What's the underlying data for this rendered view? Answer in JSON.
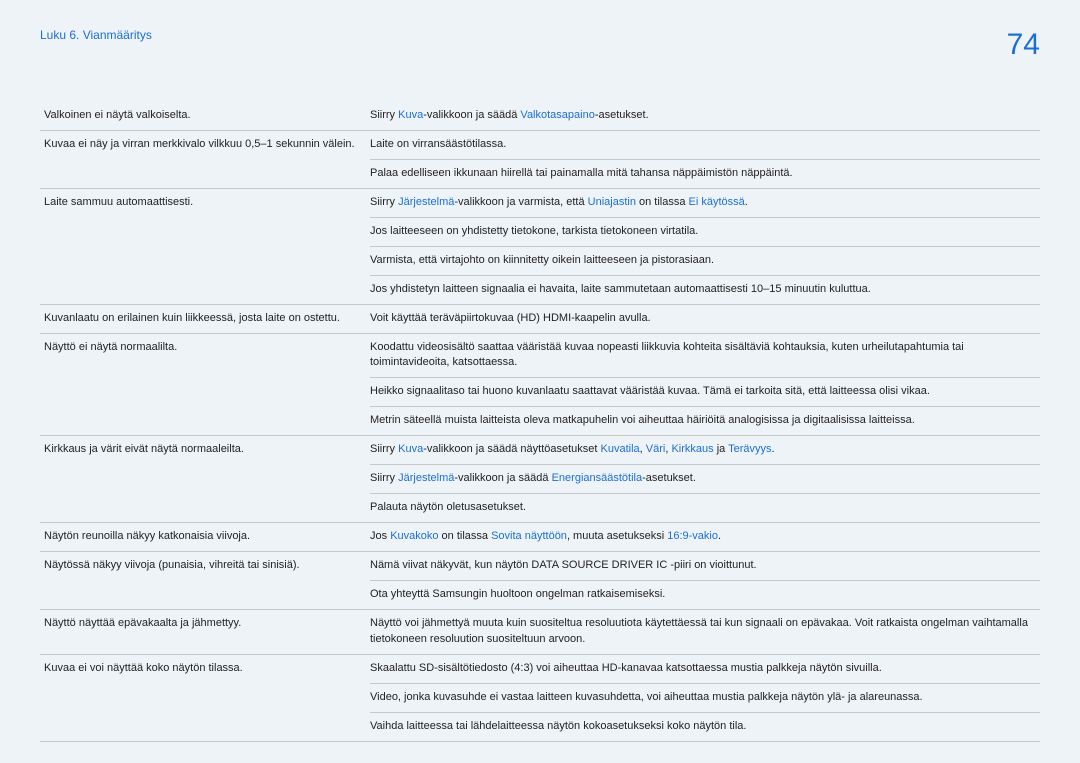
{
  "header": {
    "breadcrumb": "Luku 6. Vianmääritys",
    "page": "74"
  },
  "rows": [
    {
      "issue": "Valkoinen ei näytä valkoiselta.",
      "sols": [
        {
          "parts": [
            "Siirry ",
            {
              "hl": "Kuva"
            },
            "-valikkoon ja säädä ",
            {
              "hl": "Valkotasapaino"
            },
            "-asetukset."
          ]
        }
      ]
    },
    {
      "issue": "Kuvaa ei näy ja virran merkkivalo vilkkuu 0,5–1 sekunnin välein.",
      "sols": [
        {
          "parts": [
            "Laite on virransäästötilassa."
          ]
        },
        {
          "parts": [
            "Palaa edelliseen ikkunaan hiirellä tai painamalla mitä tahansa näppäimistön näppäintä."
          ]
        }
      ]
    },
    {
      "issue": "Laite sammuu automaattisesti.",
      "sols": [
        {
          "parts": [
            "Siirry ",
            {
              "hl": "Järjestelmä"
            },
            "-valikkoon ja varmista, että ",
            {
              "hl": "Uniajastin"
            },
            " on tilassa ",
            {
              "hl": "Ei käytössä"
            },
            "."
          ]
        },
        {
          "parts": [
            "Jos laitteeseen on yhdistetty tietokone, tarkista tietokoneen virtatila."
          ]
        },
        {
          "parts": [
            "Varmista, että virtajohto on kiinnitetty oikein laitteeseen ja pistorasiaan."
          ]
        },
        {
          "parts": [
            "Jos yhdistetyn laitteen signaalia ei havaita, laite sammutetaan automaattisesti 10–15 minuutin kuluttua."
          ]
        }
      ]
    },
    {
      "issue": "Kuvanlaatu on erilainen kuin liikkeessä, josta laite on ostettu.",
      "sols": [
        {
          "parts": [
            "Voit käyttää teräväpiirtokuvaa (HD) HDMI-kaapelin avulla."
          ]
        }
      ]
    },
    {
      "issue": "Näyttö ei näytä normaalilta.",
      "sols": [
        {
          "parts": [
            "Koodattu videosisältö saattaa vääristää kuvaa nopeasti liikkuvia kohteita sisältäviä kohtauksia, kuten urheilutapahtumia tai toimintavideoita, katsottaessa."
          ]
        },
        {
          "parts": [
            "Heikko signaalitaso tai huono kuvanlaatu saattavat vääristää kuvaa. Tämä ei tarkoita sitä, että laitteessa olisi vikaa."
          ]
        },
        {
          "parts": [
            "Metrin säteellä muista laitteista oleva matkapuhelin voi aiheuttaa häiriöitä analogisissa ja digitaalisissa laitteissa."
          ]
        }
      ]
    },
    {
      "issue": "Kirkkaus ja värit eivät näytä normaaleilta.",
      "sols": [
        {
          "parts": [
            "Siirry ",
            {
              "hl": "Kuva"
            },
            "-valikkoon ja säädä näyttöasetukset ",
            {
              "hl": "Kuvatila"
            },
            ", ",
            {
              "hl": "Väri"
            },
            ", ",
            {
              "hl": "Kirkkaus"
            },
            " ja ",
            {
              "hl": "Terävyys"
            },
            "."
          ]
        },
        {
          "parts": [
            "Siirry ",
            {
              "hl": "Järjestelmä"
            },
            "-valikkoon ja säädä ",
            {
              "hl": "Energiansäästötila"
            },
            "-asetukset."
          ]
        },
        {
          "parts": [
            "Palauta näytön oletusasetukset."
          ]
        }
      ]
    },
    {
      "issue": "Näytön reunoilla näkyy katkonaisia viivoja.",
      "sols": [
        {
          "parts": [
            "Jos ",
            {
              "hl": "Kuvakoko"
            },
            " on tilassa ",
            {
              "hl": "Sovita näyttöön"
            },
            ", muuta asetukseksi ",
            {
              "hl": "16:9-vakio"
            },
            "."
          ]
        }
      ]
    },
    {
      "issue": "Näytössä näkyy viivoja (punaisia, vihreitä tai sinisiä).",
      "sols": [
        {
          "parts": [
            "Nämä viivat näkyvät, kun näytön DATA SOURCE DRIVER IC -piiri on vioittunut."
          ]
        },
        {
          "parts": [
            "Ota yhteyttä Samsungin huoltoon ongelman ratkaisemiseksi."
          ]
        }
      ]
    },
    {
      "issue": "Näyttö näyttää epävakaalta ja jähmettyy.",
      "sols": [
        {
          "parts": [
            "Näyttö voi jähmettyä muuta kuin suositeltua resoluutiota käytettäessä tai kun signaali on epävakaa. Voit ratkaista ongelman vaihtamalla tietokoneen resoluution suositeltuun arvoon."
          ]
        }
      ]
    },
    {
      "issue": "Kuvaa ei voi näyttää koko näytön tilassa.",
      "sols": [
        {
          "parts": [
            "Skaalattu SD-sisältötiedosto (4:3) voi aiheuttaa HD-kanavaa katsottaessa mustia palkkeja näytön sivuilla."
          ]
        },
        {
          "parts": [
            "Video, jonka kuvasuhde ei vastaa laitteen kuvasuhdetta, voi aiheuttaa mustia palkkeja näytön ylä- ja alareunassa."
          ]
        },
        {
          "parts": [
            "Vaihda laitteessa tai lähdelaitteessa näytön kokoasetukseksi koko näytön tila."
          ]
        }
      ]
    }
  ]
}
